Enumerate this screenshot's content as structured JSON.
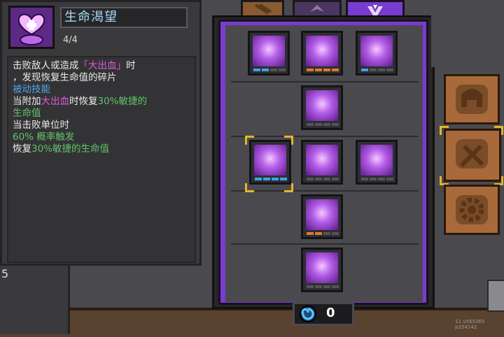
{
  "skill": {
    "name": "生命渴望",
    "level": "4/4"
  },
  "description": {
    "line1_a": "击败敌人或造成",
    "line1_b": "「大出血」",
    "line1_c": "时",
    "line2": "，发现恢复生命值的碎片",
    "line3": "被动技能",
    "line4_a": "当附加",
    "line4_b": "大出血",
    "line4_c": "时恢复",
    "line4_d": "30%敏捷的",
    "line5": "生命值",
    "line6": "当击败单位时",
    "line7": "60% 概率触发",
    "line8_a": "恢复",
    "line8_b": "30%敏捷的生命值"
  },
  "currency": {
    "count": "0"
  },
  "side_number": "5",
  "build_id": "11 u565365 p254142",
  "colors": {
    "accent_purple": "#7a3bd0",
    "pip_blue": "#3fa3e0",
    "pip_orange": "#e07a2a",
    "pip_empty": "#555",
    "highlight_pink": "#e05bd8",
    "highlight_blue": "#4fa6ee",
    "highlight_green": "#62c16a",
    "select_gold": "#e3b52a"
  },
  "skill_nodes": [
    {
      "icon": "claws-icon",
      "pips": [
        "blue",
        "blue",
        "empty",
        "empty"
      ]
    },
    {
      "icon": "slash-icon",
      "pips": [
        "orange",
        "orange",
        "orange",
        "orange"
      ]
    },
    {
      "icon": "heal-cross-icon",
      "pips": [
        "blue",
        "empty",
        "empty",
        "empty"
      ]
    },
    {
      "icon": "blades-icon",
      "pips": [
        "empty",
        "empty",
        "empty",
        "empty"
      ]
    },
    {
      "icon": "life-craving-icon",
      "pips": [
        "blue",
        "blue",
        "blue",
        "blue"
      ],
      "selected": true
    },
    {
      "icon": "rift-icon",
      "pips": [
        "empty",
        "empty",
        "empty",
        "empty"
      ]
    },
    {
      "icon": "shield-up-icon",
      "pips": [
        "empty",
        "empty",
        "empty",
        "empty"
      ]
    },
    {
      "icon": "dash-icon",
      "pips": [
        "orange",
        "orange",
        "empty",
        "empty"
      ]
    },
    {
      "icon": "swarm-blades-icon",
      "pips": [
        "empty",
        "empty",
        "empty",
        "empty"
      ]
    }
  ]
}
